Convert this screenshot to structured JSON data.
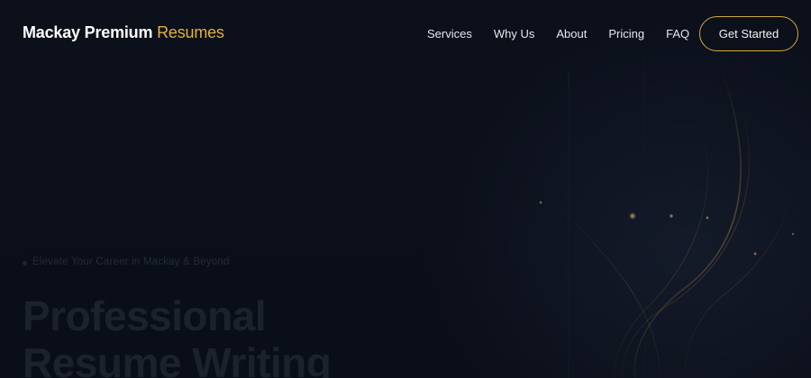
{
  "brand": {
    "name_main": "Mackay Premium",
    "name_accent": "Resumes",
    "accent_color": "#e2b23a"
  },
  "nav": {
    "items": [
      {
        "label": "Services"
      },
      {
        "label": "Why Us"
      },
      {
        "label": "About"
      },
      {
        "label": "Pricing"
      },
      {
        "label": "FAQ"
      }
    ],
    "cta_label": "Get Started",
    "cta_border_color": "#d4a93a"
  },
  "hero": {
    "eyebrow": "Elevate Your Career in Mackay & Beyond",
    "title_line1": "Professional",
    "title_line2": "Resume Writing"
  },
  "colors": {
    "background": "#0a0f1a",
    "nav_text": "#e6e6ec"
  }
}
